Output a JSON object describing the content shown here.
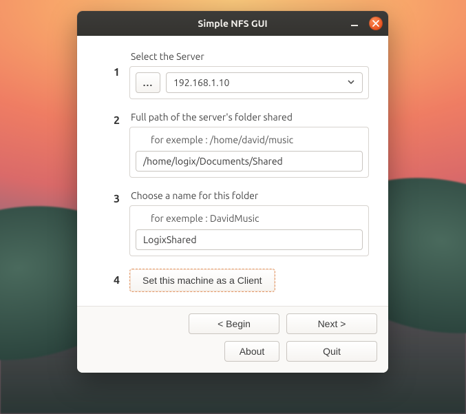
{
  "window": {
    "title": "Simple NFS GUI"
  },
  "steps": {
    "s1": {
      "num": "1",
      "label": "Select the Server",
      "browse": "...",
      "server": "192.168.1.10"
    },
    "s2": {
      "num": "2",
      "label": "Full path of the server's folder shared",
      "hint": "for exemple : /home/david/music",
      "value": "/home/logix/Documents/Shared"
    },
    "s3": {
      "num": "3",
      "label": "Choose a name for this folder",
      "hint": "for exemple : DavidMusic",
      "value": "LogixShared"
    },
    "s4": {
      "num": "4",
      "button": "Set this machine as a Client"
    }
  },
  "footer": {
    "begin": "< Begin",
    "next": "Next >",
    "about": "About",
    "quit": "Quit"
  }
}
